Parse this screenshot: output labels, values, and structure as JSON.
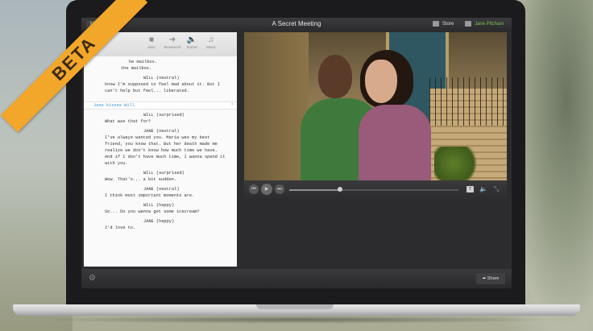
{
  "window": {
    "back_label": "Movies",
    "title": "A Secret Meeting",
    "store_label": "Store",
    "user_name": "Jane Pitcham"
  },
  "toolbar": {
    "items": [
      "ation",
      "Movement",
      "Sound",
      "Music"
    ]
  },
  "script": {
    "lines": [
      "he mailbox.",
      "the mailbox.",
      "WILL (neutral)",
      "know I'm supposed to feel mad about it. But I",
      "can't help but feel... liberated.",
      "Jane kisses Will.",
      "WILL (surprised)",
      "What was that for?",
      "JANE (neutral)",
      "I've always wanted you. Maria was my best",
      "friend, you know that. But her death made me",
      "realize we don't know how much time we have.",
      "And if I don't have much time, I wanna spend it",
      "with you.",
      "WILL (surprised)",
      "Wow. That's... a bit sudden.",
      "JANE (neutral)",
      "I think most important moments are.",
      "WILL (happy)",
      "So... Do you wanna get some icecream?",
      "JANE (happy)",
      "I'd love to."
    ]
  },
  "player": {
    "cc_label": "T",
    "progress_fraction": 0.3
  },
  "bottom": {
    "share_label": "Share"
  },
  "ribbon": {
    "label": "BETA",
    "color": "#f2a72b"
  },
  "colors": {
    "user_accent": "#7cc04a",
    "link_blue": "#3a8fd8"
  }
}
